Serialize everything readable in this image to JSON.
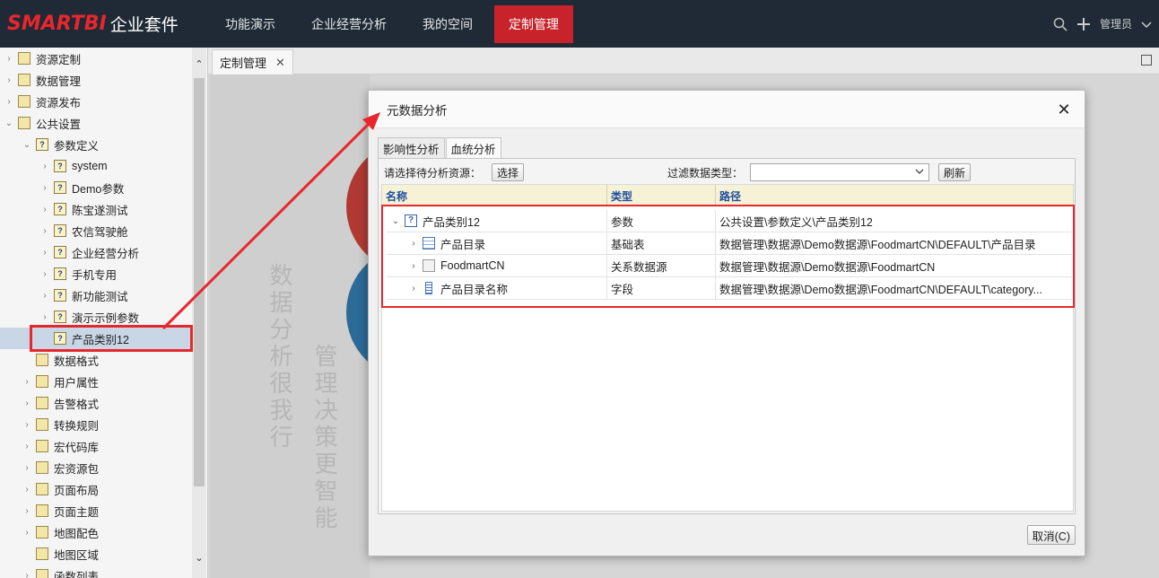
{
  "app": {
    "brand": "SMARTBI",
    "suite": "企业套件"
  },
  "nav": [
    {
      "label": "功能演示"
    },
    {
      "label": "企业经营分析"
    },
    {
      "label": "我的空间"
    },
    {
      "label": "定制管理"
    }
  ],
  "topright": {
    "user": "管理员"
  },
  "sidebar": {
    "items": [
      {
        "label": "资源定制",
        "arrow": ">",
        "icon": "folder-icon"
      },
      {
        "label": "数据管理",
        "arrow": ">",
        "icon": "folder-icon"
      },
      {
        "label": "资源发布",
        "arrow": ">",
        "icon": "publish-icon"
      },
      {
        "label": "公共设置",
        "arrow": "v",
        "icon": "settings-icon"
      },
      {
        "label": "参数定义",
        "arrow": "v",
        "icon": "param-folder-icon"
      },
      {
        "label": "system",
        "arrow": ">",
        "icon": "param-icon"
      },
      {
        "label": "Demo参数",
        "arrow": ">",
        "icon": "param-icon"
      },
      {
        "label": "陈宝遂测试",
        "arrow": ">",
        "icon": "param-icon"
      },
      {
        "label": "农信驾驶舱",
        "arrow": ">",
        "icon": "param-icon"
      },
      {
        "label": "企业经营分析",
        "arrow": ">",
        "icon": "param-icon"
      },
      {
        "label": "手机专用",
        "arrow": ">",
        "icon": "param-icon"
      },
      {
        "label": "新功能测试",
        "arrow": ">",
        "icon": "param-icon"
      },
      {
        "label": "演示示例参数",
        "arrow": ">",
        "icon": "param-icon"
      },
      {
        "label": "产品类别12",
        "arrow": "",
        "icon": "param-icon"
      },
      {
        "label": "数据格式",
        "arrow": "",
        "icon": "format-icon"
      },
      {
        "label": "用户属性",
        "arrow": ">",
        "icon": "hand-icon"
      },
      {
        "label": "告警格式",
        "arrow": ">",
        "icon": "alert-icon"
      },
      {
        "label": "转换规则",
        "arrow": ">",
        "icon": "convert-icon"
      },
      {
        "label": "宏代码库",
        "arrow": ">",
        "icon": "macro-icon"
      },
      {
        "label": "宏资源包",
        "arrow": ">",
        "icon": "package-icon"
      },
      {
        "label": "页面布局",
        "arrow": ">",
        "icon": "layout-icon"
      },
      {
        "label": "页面主题",
        "arrow": ">",
        "icon": "theme-icon"
      },
      {
        "label": "地图配色",
        "arrow": ">",
        "icon": "map-color-icon"
      },
      {
        "label": "地图区域",
        "arrow": "",
        "icon": "map-area-icon"
      },
      {
        "label": "函数列表",
        "arrow": ">",
        "icon": "function-icon"
      }
    ]
  },
  "tab": {
    "label": "定制管理",
    "close": "✕"
  },
  "background": {
    "text_left": "数据分析很我行",
    "text_right": "管理决策更智能"
  },
  "dialog": {
    "title": "元数据分析",
    "close": "✕",
    "tabs": [
      "影响性分析",
      "血统分析"
    ],
    "select_label": "请选择待分析资源：",
    "select_button": "选择",
    "filter_label": "过滤数据类型：",
    "filter_value": "",
    "refresh_button": "刷新",
    "columns": [
      "名称",
      "类型",
      "路径"
    ],
    "rows": [
      {
        "exp": "v",
        "icon": "param",
        "name": "产品类别12",
        "type": "参数",
        "path": "公共设置\\参数定义\\产品类别12"
      },
      {
        "exp": ">",
        "icon": "table",
        "name": "产品目录",
        "type": "基础表",
        "path": "数据管理\\数据源\\Demo数据源\\FoodmartCN\\DEFAULT\\产品目录"
      },
      {
        "exp": ">",
        "icon": "db",
        "name": "FoodmartCN",
        "type": "关系数据源",
        "path": "数据管理\\数据源\\Demo数据源\\FoodmartCN"
      },
      {
        "exp": ">",
        "icon": "field",
        "name": "产品目录名称",
        "type": "字段",
        "path": "数据管理\\数据源\\Demo数据源\\FoodmartCN\\DEFAULT\\category..."
      }
    ],
    "cancel_button": "取消(C)"
  }
}
